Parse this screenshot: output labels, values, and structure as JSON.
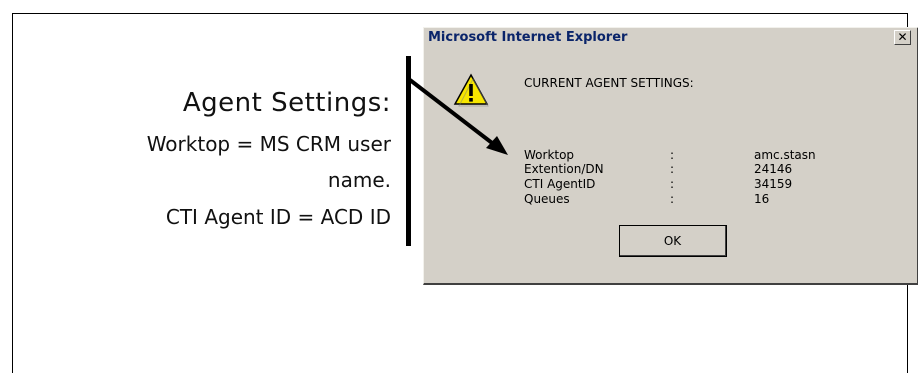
{
  "callout": {
    "title": "Agent Settings:",
    "line1": "Worktop = MS CRM user",
    "line2": "name.",
    "line3": "CTI Agent ID = ACD ID"
  },
  "dialog": {
    "title": "Microsoft Internet Explorer",
    "close_label": "✕",
    "icon": "warning-icon",
    "heading": "CURRENT AGENT SETTINGS:",
    "rows": [
      {
        "label": "Worktop",
        "sep": ":",
        "value": "amc.stasn"
      },
      {
        "label": "Extention/DN",
        "sep": ":",
        "value": "24146"
      },
      {
        "label": "CTI AgentID",
        "sep": ":",
        "value": "34159"
      },
      {
        "label": "Queues",
        "sep": ":",
        "value": "16"
      }
    ],
    "ok_label": "OK"
  },
  "colors": {
    "dialog_face": "#d4d0c8",
    "title_text": "#0a246a",
    "warning_yellow": "#f7e600"
  }
}
